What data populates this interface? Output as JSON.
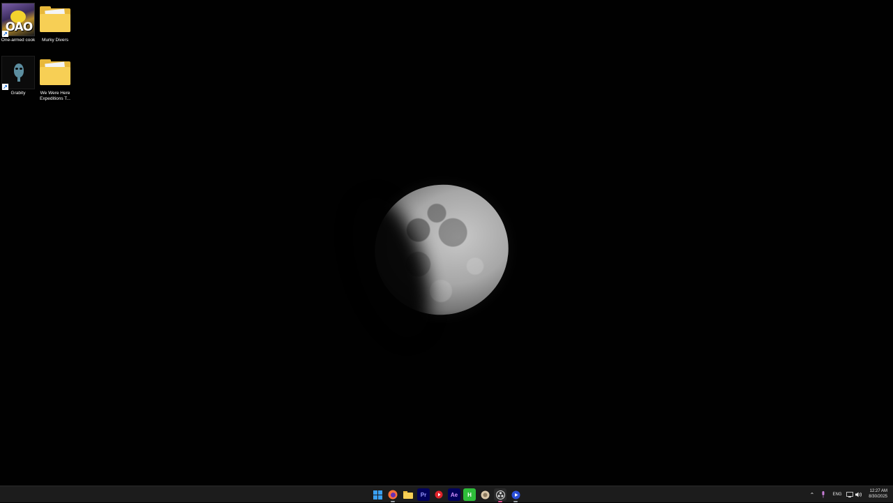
{
  "desktop": {
    "icons": [
      {
        "label": "One-armed cook",
        "icon": "game-icon",
        "shortcut": true
      },
      {
        "label": "Murky Divers",
        "icon": "folder-icon",
        "shortcut": false
      },
      {
        "label": "Grabity",
        "icon": "alien-icon",
        "shortcut": true
      },
      {
        "label": "We Were Here Expeditions T...",
        "icon": "folder-icon",
        "shortcut": false
      }
    ],
    "game_art_text": "OAO"
  },
  "taskbar": {
    "apps": [
      {
        "name": "start-button",
        "icon": "windows-logo-icon"
      },
      {
        "name": "firefox",
        "icon": "firefox-icon"
      },
      {
        "name": "file-explorer",
        "icon": "folder-icon"
      },
      {
        "name": "premiere-pro",
        "icon": "premiere-icon",
        "text": "Pr"
      },
      {
        "name": "red-app",
        "icon": "red-circle-icon"
      },
      {
        "name": "after-effects",
        "icon": "after-effects-icon",
        "text": "Ae"
      },
      {
        "name": "h-app",
        "icon": "h-icon",
        "text": "H"
      },
      {
        "name": "app-round",
        "icon": "round-app-icon"
      },
      {
        "name": "obs",
        "icon": "obs-icon"
      },
      {
        "name": "media-player",
        "icon": "play-icon"
      }
    ],
    "tray": {
      "language": "ENG",
      "time": "12:27 AM",
      "date": "8/30/2025"
    }
  },
  "colors": {
    "taskbar_bg": "#1c1c1c",
    "windows_blue": "#3aa0f3",
    "folder_yellow": "#f7cf55"
  }
}
